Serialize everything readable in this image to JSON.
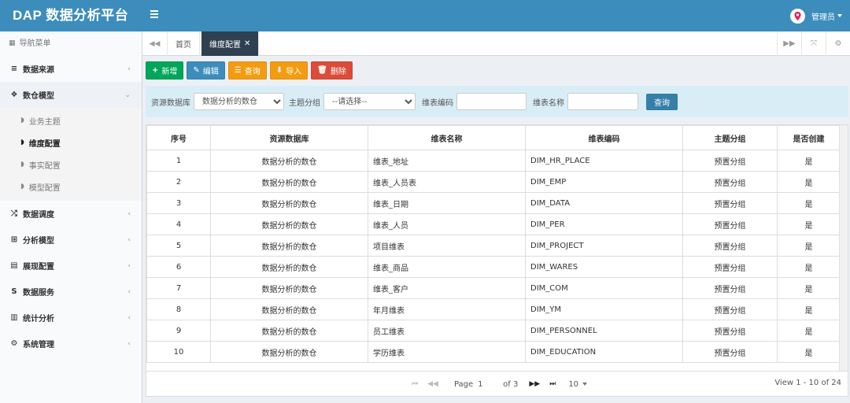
{
  "app": {
    "title": "DAP 数据分析平台",
    "user": "管理员"
  },
  "sidebar": {
    "header": "导航菜单",
    "items": [
      {
        "label": "数据来源",
        "icon": "database-icon"
      },
      {
        "label": "数仓模型",
        "icon": "cubes-icon",
        "open": true,
        "children": [
          {
            "label": "业务主题",
            "icon": "leaf-icon"
          },
          {
            "label": "维度配置",
            "icon": "leaf-icon",
            "active": true
          },
          {
            "label": "事实配置",
            "icon": "leaf-icon"
          },
          {
            "label": "模型配置",
            "icon": "leaf-icon"
          }
        ]
      },
      {
        "label": "数据调度",
        "icon": "random-icon"
      },
      {
        "label": "分析模型",
        "icon": "sitemap-icon"
      },
      {
        "label": "展现配置",
        "icon": "film-icon"
      },
      {
        "label": "数据服务",
        "icon": "dollar-icon"
      },
      {
        "label": "统计分析",
        "icon": "bar-chart-icon"
      },
      {
        "label": "系统管理",
        "icon": "gear-icon"
      }
    ]
  },
  "tabs": {
    "home": "首页",
    "active": "维度配置"
  },
  "toolbar": {
    "add": "新增",
    "edit": "编辑",
    "query": "查询",
    "import": "导入",
    "delete": "删除"
  },
  "search": {
    "db_label": "资源数据库",
    "db_value": "数据分析的数仓",
    "group_label": "主题分组",
    "group_value": "--请选择--",
    "code_label": "维表编码",
    "name_label": "维表名称",
    "query": "查询"
  },
  "table": {
    "headers": [
      "序号",
      "资源数据库",
      "维表名称",
      "维表编码",
      "主题分组",
      "是否创建"
    ],
    "rows": [
      [
        "1",
        "数据分析的数仓",
        "维表_地址",
        "DIM_HR_PLACE",
        "预置分组",
        "是"
      ],
      [
        "2",
        "数据分析的数仓",
        "维表_人员表",
        "DIM_EMP",
        "预置分组",
        "是"
      ],
      [
        "3",
        "数据分析的数仓",
        "维表_日期",
        "DIM_DATA",
        "预置分组",
        "是"
      ],
      [
        "4",
        "数据分析的数仓",
        "维表_人员",
        "DIM_PER",
        "预置分组",
        "是"
      ],
      [
        "5",
        "数据分析的数仓",
        "项目维表",
        "DIM_PROJECT",
        "预置分组",
        "是"
      ],
      [
        "6",
        "数据分析的数仓",
        "维表_商品",
        "DIM_WARES",
        "预置分组",
        "是"
      ],
      [
        "7",
        "数据分析的数仓",
        "维表_客户",
        "DIM_COM",
        "预置分组",
        "是"
      ],
      [
        "8",
        "数据分析的数仓",
        "年月维表",
        "DIM_YM",
        "预置分组",
        "是"
      ],
      [
        "9",
        "数据分析的数仓",
        "员工维表",
        "DIM_PERSONNEL",
        "预置分组",
        "是"
      ],
      [
        "10",
        "数据分析的数仓",
        "学历维表",
        "DIM_EDUCATION",
        "预置分组",
        "是"
      ]
    ]
  },
  "pager": {
    "page_label": "Page",
    "page": "1",
    "of": "of 3",
    "size": "10",
    "view": "View 1 - 10 of 24"
  },
  "colors": {
    "header": "#3c8dbc",
    "add": "#00a65a",
    "edit": "#3c8dbc",
    "query": "#f39c12",
    "delete": "#dd4b39"
  }
}
